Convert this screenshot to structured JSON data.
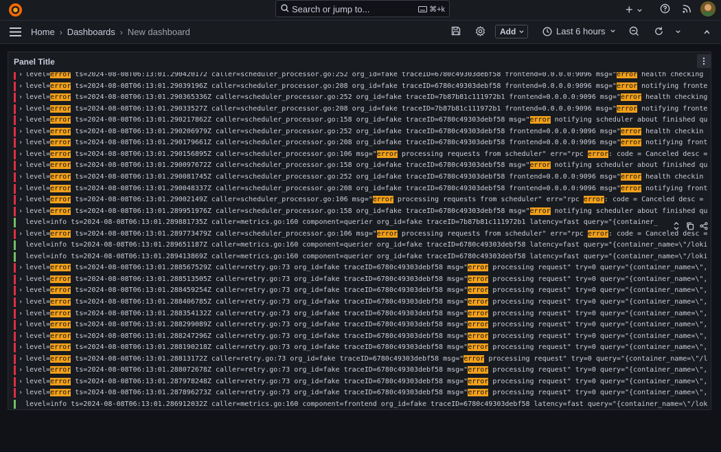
{
  "topbar": {
    "search_placeholder": "Search or jump to...",
    "search_shortcut": "⌘+k",
    "plus_label": "+"
  },
  "breadcrumb": {
    "home": "Home",
    "dashboards": "Dashboards",
    "current": "New dashboard"
  },
  "toolbar": {
    "add_label": "Add",
    "time_range": "Last 6 hours"
  },
  "panel": {
    "title": "Panel Title"
  },
  "colors": {
    "error_bar": "#e02f44",
    "info_bar": "#73bf69",
    "highlight": "#f2a01a"
  },
  "logs": [
    {
      "level": "error",
      "pre": "level=",
      "mid": " ts=2024-08-08T06:13:01.290420172 caller=scheduler_processor.go:252 org_id=fake traceID=6780c49303debf58 frontend=0.0.0.0:9096 msg=\"",
      "post": " health checking"
    },
    {
      "level": "error",
      "pre": "level=",
      "mid": " ts=2024-08-08T06:13:01.29039196Z caller=scheduler_processor.go:208 org_id=fake traceID=6780c49303debf58 frontend=0.0.0.0:9096 msg=\"",
      "post": " notifying fronte"
    },
    {
      "level": "error",
      "pre": "level=",
      "mid": " ts=2024-08-08T06:13:01.290365336Z caller=scheduler_processor.go:252 org_id=fake traceID=7b87b81c111972b1 frontend=0.0.0.0:9096 msg=\"",
      "post": " health checking"
    },
    {
      "level": "error",
      "pre": "level=",
      "mid": " ts=2024-08-08T06:13:01.29033527Z caller=scheduler_processor.go:208 org_id=fake traceID=7b87b81c111972b1 frontend=0.0.0.0:9096 msg=\"",
      "post": " notifying fronte"
    },
    {
      "level": "error",
      "pre": "level=",
      "mid": " ts=2024-08-08T06:13:01.290217862Z caller=scheduler_processor.go:158 org_id=fake traceID=6780c49303debf58 msg=\"",
      "post": " notifying scheduler about finished qu"
    },
    {
      "level": "error",
      "pre": "level=",
      "mid": " ts=2024-08-08T06:13:01.290206979Z caller=scheduler_processor.go:252 org_id=fake traceID=6780c49303debf58 frontend=0.0.0.0:9096 msg=\"",
      "post": " health checkin"
    },
    {
      "level": "error",
      "pre": "level=",
      "mid": " ts=2024-08-08T06:13:01.290179661Z caller=scheduler_processor.go:208 org_id=fake traceID=6780c49303debf58 frontend=0.0.0.0:9096 msg=\"",
      "post": " notifying front"
    },
    {
      "level": "error",
      "pre": "level=",
      "mid": " ts=2024-08-08T06:13:01.290156895Z caller=scheduler_processor.go:106 msg=\"",
      "post": " processing requests from scheduler\" err=\"rpc ",
      "post2": ": code = Canceled desc ="
    },
    {
      "level": "error",
      "pre": "level=",
      "mid": " ts=2024-08-08T06:13:01.290097672Z caller=scheduler_processor.go:158 org_id=fake traceID=6780c49303debf58 msg=\"",
      "post": " notifying scheduler about finished qu"
    },
    {
      "level": "error",
      "pre": "level=",
      "mid": " ts=2024-08-08T06:13:01.290081745Z caller=scheduler_processor.go:252 org_id=fake traceID=6780c49303debf58 frontend=0.0.0.0:9096 msg=\"",
      "post": " health checkin"
    },
    {
      "level": "error",
      "pre": "level=",
      "mid": " ts=2024-08-08T06:13:01.290048337Z caller=scheduler_processor.go:208 org_id=fake traceID=6780c49303debf58 frontend=0.0.0.0:9096 msg=\"",
      "post": " notifying front"
    },
    {
      "level": "error",
      "pre": "level=",
      "mid": " ts=2024-08-08T06:13:01.29002149Z caller=scheduler_processor.go:106 msg=\"",
      "post": " processing requests from scheduler\" err=\"rpc ",
      "post2": ": code = Canceled desc ="
    },
    {
      "level": "error",
      "pre": "level=",
      "mid": " ts=2024-08-08T06:13:01.289951976Z caller=scheduler_processor.go:158 org_id=fake traceID=6780c49303debf58 msg=\"",
      "post": " notifying scheduler about finished qu"
    },
    {
      "level": "info",
      "plain": "level=info ts=2024-08-08T06:13:01.289881735Z caller=metrics.go:160 component=querier org_id=fake traceID=7b87b81c111972b1 latency=fast query=\"{container_"
    },
    {
      "level": "error",
      "pre": "level=",
      "mid": " ts=2024-08-08T06:13:01.289773479Z caller=scheduler_processor.go:106 msg=\"",
      "post": " processing requests from scheduler\" err=\"rpc ",
      "post2": ": code = Canceled desc ="
    },
    {
      "level": "info",
      "plain": "level=info ts=2024-08-08T06:13:01.289651187Z caller=metrics.go:160 component=querier org_id=fake traceID=6780c49303debf58 latency=fast query=\"{container_name=\\\"/loki"
    },
    {
      "level": "info",
      "plain": "level=info ts=2024-08-08T06:13:01.289413869Z caller=metrics.go:160 component=querier org_id=fake traceID=6780c49303debf58 latency=fast query=\"{container_name=\\\"/loki"
    },
    {
      "level": "error",
      "pre": "level=",
      "mid": " ts=2024-08-08T06:13:01.288567529Z caller=retry.go:73 org_id=fake traceID=6780c49303debf58 msg=\"",
      "post": " processing request\" try=0 query=\"{container_name=\\\","
    },
    {
      "level": "error",
      "pre": "level=",
      "mid": " ts=2024-08-08T06:13:01.288513505Z caller=retry.go:73 org_id=fake traceID=6780c49303debf58 msg=\"",
      "post": " processing request\" try=0 query=\"{container_name=\\\","
    },
    {
      "level": "error",
      "pre": "level=",
      "mid": " ts=2024-08-08T06:13:01.288459254Z caller=retry.go:73 org_id=fake traceID=6780c49303debf58 msg=\"",
      "post": " processing request\" try=0 query=\"{container_name=\\\","
    },
    {
      "level": "error",
      "pre": "level=",
      "mid": " ts=2024-08-08T06:13:01.288406785Z caller=retry.go:73 org_id=fake traceID=6780c49303debf58 msg=\"",
      "post": " processing request\" try=0 query=\"{container_name=\\\","
    },
    {
      "level": "error",
      "pre": "level=",
      "mid": " ts=2024-08-08T06:13:01.288354132Z caller=retry.go:73 org_id=fake traceID=6780c49303debf58 msg=\"",
      "post": " processing request\" try=0 query=\"{container_name=\\\","
    },
    {
      "level": "error",
      "pre": "level=",
      "mid": " ts=2024-08-08T06:13:01.288299089Z caller=retry.go:73 org_id=fake traceID=6780c49303debf58 msg=\"",
      "post": " processing request\" try=0 query=\"{container_name=\\\","
    },
    {
      "level": "error",
      "pre": "level=",
      "mid": " ts=2024-08-08T06:13:01.288247296Z caller=retry.go:73 org_id=fake traceID=6780c49303debf58 msg=\"",
      "post": " processing request\" try=0 query=\"{container_name=\\\","
    },
    {
      "level": "error",
      "pre": "level=",
      "mid": " ts=2024-08-08T06:13:01.288190218Z caller=retry.go:73 org_id=fake traceID=6780c49303debf58 msg=\"",
      "post": " processing request\" try=0 query=\"{container_name=\\\","
    },
    {
      "level": "error",
      "pre": "level=",
      "mid": " ts=2024-08-08T06:13:01.28813172Z caller=retry.go:73 org_id=fake traceID=6780c49303debf58 msg=\"",
      "post": " processing request\" try=0 query=\"{container_name=\\\"/l"
    },
    {
      "level": "error",
      "pre": "level=",
      "mid": " ts=2024-08-08T06:13:01.288072678Z caller=retry.go:73 org_id=fake traceID=6780c49303debf58 msg=\"",
      "post": " processing request\" try=0 query=\"{container_name=\\\","
    },
    {
      "level": "error",
      "pre": "level=",
      "mid": " ts=2024-08-08T06:13:01.287978248Z caller=retry.go:73 org_id=fake traceID=6780c49303debf58 msg=\"",
      "post": " processing request\" try=0 query=\"{container_name=\\\","
    },
    {
      "level": "error",
      "pre": "level=",
      "mid": " ts=2024-08-08T06:13:01.287896273Z caller=retry.go:73 org_id=fake traceID=6780c49303debf58 msg=\"",
      "post": " processing request\" try=0 query=\"{container_name=\\\","
    },
    {
      "level": "info",
      "plain": "level=info ts=2024-08-08T06:13:01.286912032Z caller=metrics.go:160 component=frontend org_id=fake traceID=6780c49303debf58 latency=fast query=\"{container_name=\\\"/lok"
    }
  ],
  "error_word": "error"
}
